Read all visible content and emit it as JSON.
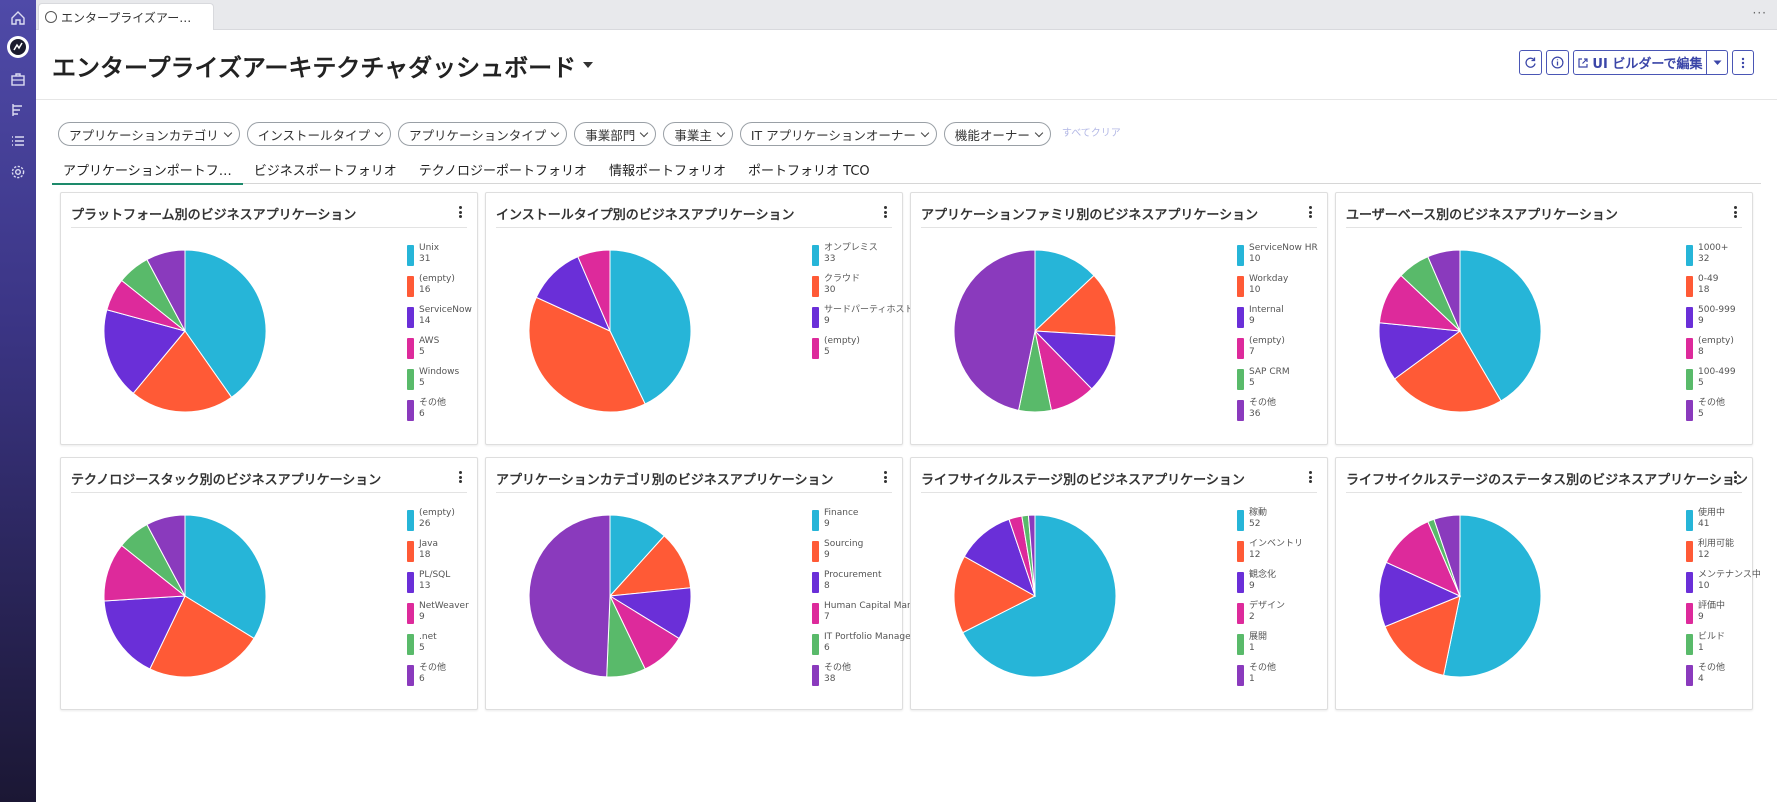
{
  "browser_tab": {
    "title": "エンタープライズアー…"
  },
  "page": {
    "title": "エンタープライズアーキテクチャダッシュボード"
  },
  "header_actions": {
    "edit_label": "UI ビルダーで編集"
  },
  "filters": [
    {
      "label": "アプリケーションカテゴリ"
    },
    {
      "label": "インストールタイプ"
    },
    {
      "label": "アプリケーションタイプ"
    },
    {
      "label": "事業部門"
    },
    {
      "label": "事業主"
    },
    {
      "label": "IT アプリケーションオーナー"
    },
    {
      "label": "機能オーナー"
    }
  ],
  "clear_all_label": "すべてクリア",
  "tabs": [
    {
      "label": "アプリケーションポートフ…",
      "active": true
    },
    {
      "label": "ビジネスポートフォリオ"
    },
    {
      "label": "テクノロジーポートフォリオ"
    },
    {
      "label": "情報ポートフォリオ"
    },
    {
      "label": "ポートフォリオ TCO"
    }
  ],
  "colors": [
    "#26b5d8",
    "#ff5a36",
    "#6a2fd8",
    "#dd2a9b",
    "#59ba6a",
    "#8a3abd"
  ],
  "chart_data": [
    {
      "type": "pie",
      "title": "プラットフォーム別のビジネスアプリケーション",
      "labels": [
        "Unix",
        "(empty)",
        "ServiceNow",
        "AWS",
        "Windows",
        "その他"
      ],
      "values": [
        31,
        16,
        14,
        5,
        5,
        6
      ]
    },
    {
      "type": "pie",
      "title": "インストールタイプ別のビジネスアプリケーション",
      "labels": [
        "オンプレミス",
        "クラウド",
        "サードパーティホスト",
        "(empty)"
      ],
      "values": [
        33,
        30,
        9,
        5
      ]
    },
    {
      "type": "pie",
      "title": "アプリケーションファミリ別のビジネスアプリケーション",
      "labels": [
        "ServiceNow HR",
        "Workday",
        "Internal",
        "(empty)",
        "SAP CRM",
        "その他"
      ],
      "values": [
        10,
        10,
        9,
        7,
        5,
        36
      ]
    },
    {
      "type": "pie",
      "title": "ユーザーベース別のビジネスアプリケーション",
      "labels": [
        "1000+",
        "0-49",
        "500-999",
        "(empty)",
        "100-499",
        "その他"
      ],
      "values": [
        32,
        18,
        9,
        8,
        5,
        5
      ]
    },
    {
      "type": "pie",
      "title": "テクノロジースタック別のビジネスアプリケーション",
      "labels": [
        "(empty)",
        "Java",
        "PL/SQL",
        "NetWeaver",
        ".net",
        "その他"
      ],
      "values": [
        26,
        18,
        13,
        9,
        5,
        6
      ]
    },
    {
      "type": "pie",
      "title": "アプリケーションカテゴリ別のビジネスアプリケーション",
      "labels": [
        "Finance",
        "Sourcing",
        "Procurement",
        "Human Capital Management",
        "IT Portfolio Management",
        "その他"
      ],
      "values": [
        9,
        9,
        8,
        7,
        6,
        38
      ]
    },
    {
      "type": "pie",
      "title": "ライフサイクルステージ別のビジネスアプリケーション",
      "labels": [
        "稼動",
        "インベントリ",
        "観念化",
        "デザイン",
        "展開",
        "その他"
      ],
      "values": [
        52,
        12,
        9,
        2,
        1,
        1
      ]
    },
    {
      "type": "pie",
      "title": "ライフサイクルステージのステータス別のビジネスアプリケーション",
      "labels": [
        "使用中",
        "利用可能",
        "メンテナンス中",
        "評価中",
        "ビルド",
        "その他"
      ],
      "values": [
        41,
        12,
        10,
        9,
        1,
        4
      ]
    }
  ]
}
